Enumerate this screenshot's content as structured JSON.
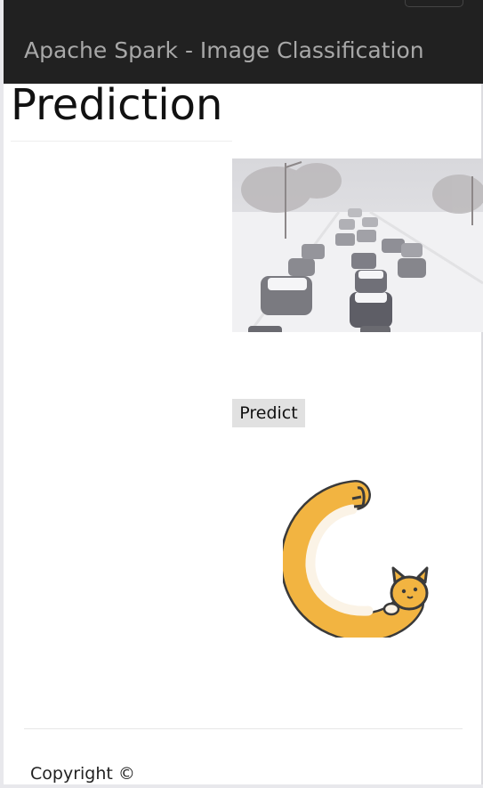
{
  "navbar": {
    "brand": "Apache Spark - Image Classification"
  },
  "main": {
    "title": "Prediction",
    "image_icon": "snowy-road-traffic-photo",
    "predict_label": "Predict",
    "loader_icon": "cat-loading-spinner-icon"
  },
  "footer": {
    "copyright": "Copyright ©"
  },
  "colors": {
    "navbar_bg": "#212121",
    "brand_text": "#a8a8a8",
    "button_bg": "#e1e1e1",
    "cat_orange": "#f2b441"
  }
}
